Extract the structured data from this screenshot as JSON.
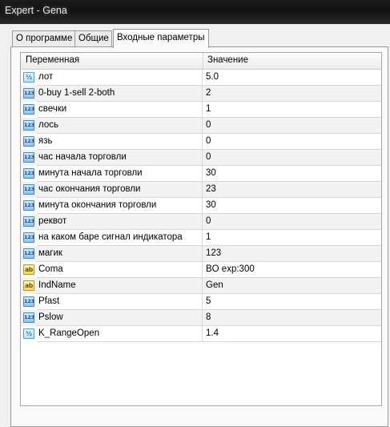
{
  "window": {
    "title": "Expert - Gena"
  },
  "tabs": [
    {
      "label": "О программе",
      "active": false
    },
    {
      "label": "Общие",
      "active": false
    },
    {
      "label": "Входные параметры",
      "active": true
    }
  ],
  "grid": {
    "col_name": "Переменная",
    "col_value": "Значение",
    "rows": [
      {
        "icon": "double-type-icon",
        "name": "лот",
        "value": "5.0"
      },
      {
        "icon": "int-type-icon",
        "name": "0-buy 1-sell 2-both",
        "value": "2"
      },
      {
        "icon": "int-type-icon",
        "name": "свечки",
        "value": "1"
      },
      {
        "icon": "int-type-icon",
        "name": "лось",
        "value": "0"
      },
      {
        "icon": "int-type-icon",
        "name": "язь",
        "value": "0"
      },
      {
        "icon": "int-type-icon",
        "name": "час начала торговли",
        "value": "0"
      },
      {
        "icon": "int-type-icon",
        "name": "минута начала торговли",
        "value": "30"
      },
      {
        "icon": "int-type-icon",
        "name": "час окончания торговли",
        "value": "23"
      },
      {
        "icon": "int-type-icon",
        "name": "минута окончания торговли",
        "value": "30"
      },
      {
        "icon": "int-type-icon",
        "name": "реквот",
        "value": "0"
      },
      {
        "icon": "int-type-icon",
        "name": "на каком баре сигнал индикатора",
        "value": "1"
      },
      {
        "icon": "int-type-icon",
        "name": "магик",
        "value": "123"
      },
      {
        "icon": "string-type-icon",
        "name": "Coma",
        "value": "BO exp:300"
      },
      {
        "icon": "string-type-icon",
        "name": "IndName",
        "value": "Gen"
      },
      {
        "icon": "int-type-icon",
        "name": "Pfast",
        "value": "5"
      },
      {
        "icon": "int-type-icon",
        "name": "Pslow",
        "value": "8"
      },
      {
        "icon": "double-type-icon",
        "name": "K_RangeOpen",
        "value": "1.4"
      }
    ]
  },
  "icon_glyphs": {
    "int-type-icon": "123",
    "double-type-icon": "½",
    "string-type-icon": "ab"
  }
}
